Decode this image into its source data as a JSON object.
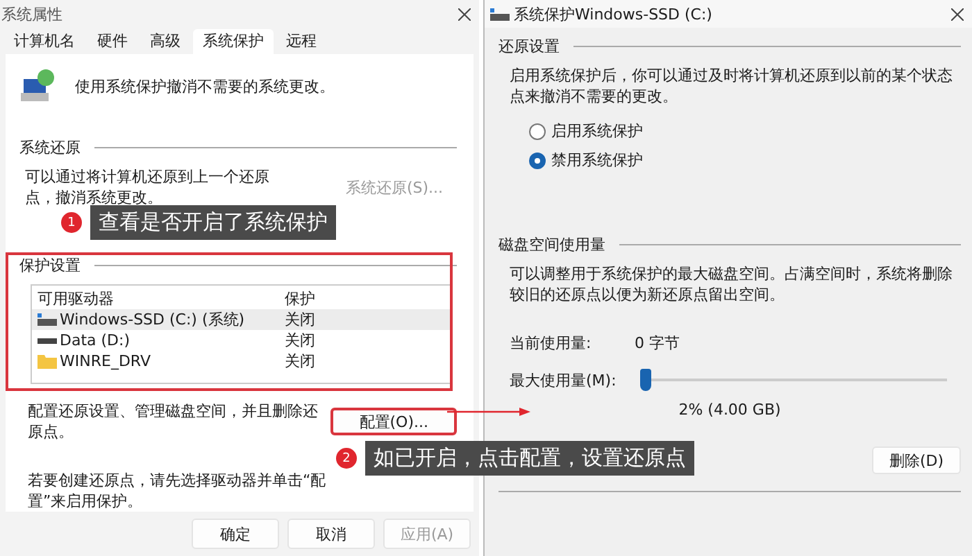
{
  "left_window": {
    "title": "系统属性",
    "tabs": [
      {
        "label": "计算机名",
        "selected": false
      },
      {
        "label": "硬件",
        "selected": false
      },
      {
        "label": "高级",
        "selected": false
      },
      {
        "label": "系统保护",
        "selected": true
      },
      {
        "label": "远程",
        "selected": false
      }
    ],
    "description": "使用系统保护撤消不需要的系统更改。",
    "system_restore": {
      "heading": "系统还原",
      "text": "可以通过将计算机还原到上一个还原点，撤消系统更改。",
      "button": {
        "label": "系统还原(S)...",
        "disabled": true
      }
    },
    "protection": {
      "heading": "保护设置",
      "columns": [
        "可用驱动器",
        "保护"
      ],
      "rows": [
        {
          "kind": "system",
          "name": "Windows-SSD (C:) (系统)",
          "protection": "关闭",
          "selected": true
        },
        {
          "kind": "drive",
          "name": "Data (D:)",
          "protection": "关闭",
          "selected": false
        },
        {
          "kind": "folder",
          "name": "WINRE_DRV",
          "protection": "关闭",
          "selected": false
        }
      ]
    },
    "configure_text": "配置还原设置、管理磁盘空间，并且删除还原点。",
    "configure_button": {
      "label": "配置(O)...",
      "disabled": false
    },
    "create_text": "若要创建还原点，请先选择驱动器并单击“配置”来启用保护。",
    "buttons": [
      {
        "label": "确定",
        "disabled": false
      },
      {
        "label": "取消",
        "disabled": false
      },
      {
        "label": "应用(A)",
        "disabled": true
      }
    ]
  },
  "right_window": {
    "title": "系统保护Windows-SSD (C:)",
    "restore_settings": {
      "heading": "还原设置",
      "text": "启用系统保护后，你可以通过及时将计算机还原到以前的某个状态点来撤消不需要的更改。",
      "options": [
        {
          "label": "启用系统保护",
          "selected": false
        },
        {
          "label": "禁用系统保护",
          "selected": true
        }
      ]
    },
    "disk_usage": {
      "heading": "磁盘空间使用量",
      "text": "可以调整用于系统保护的最大磁盘空间。占满空间时，系统将删除较旧的还原点以便为新还原点留出空间。",
      "current_label": "当前使用量:",
      "current_value": "0 字节",
      "max_label": "最大使用量(M):",
      "level": 0.02,
      "reading": "2% (4.00 GB)",
      "delete_button": "删除(D)"
    }
  },
  "annotations": [
    {
      "number": "1",
      "text": "查看是否开启了系统保护"
    },
    {
      "number": "2",
      "text": "如已开启，点击配置，设置还原点"
    }
  ]
}
